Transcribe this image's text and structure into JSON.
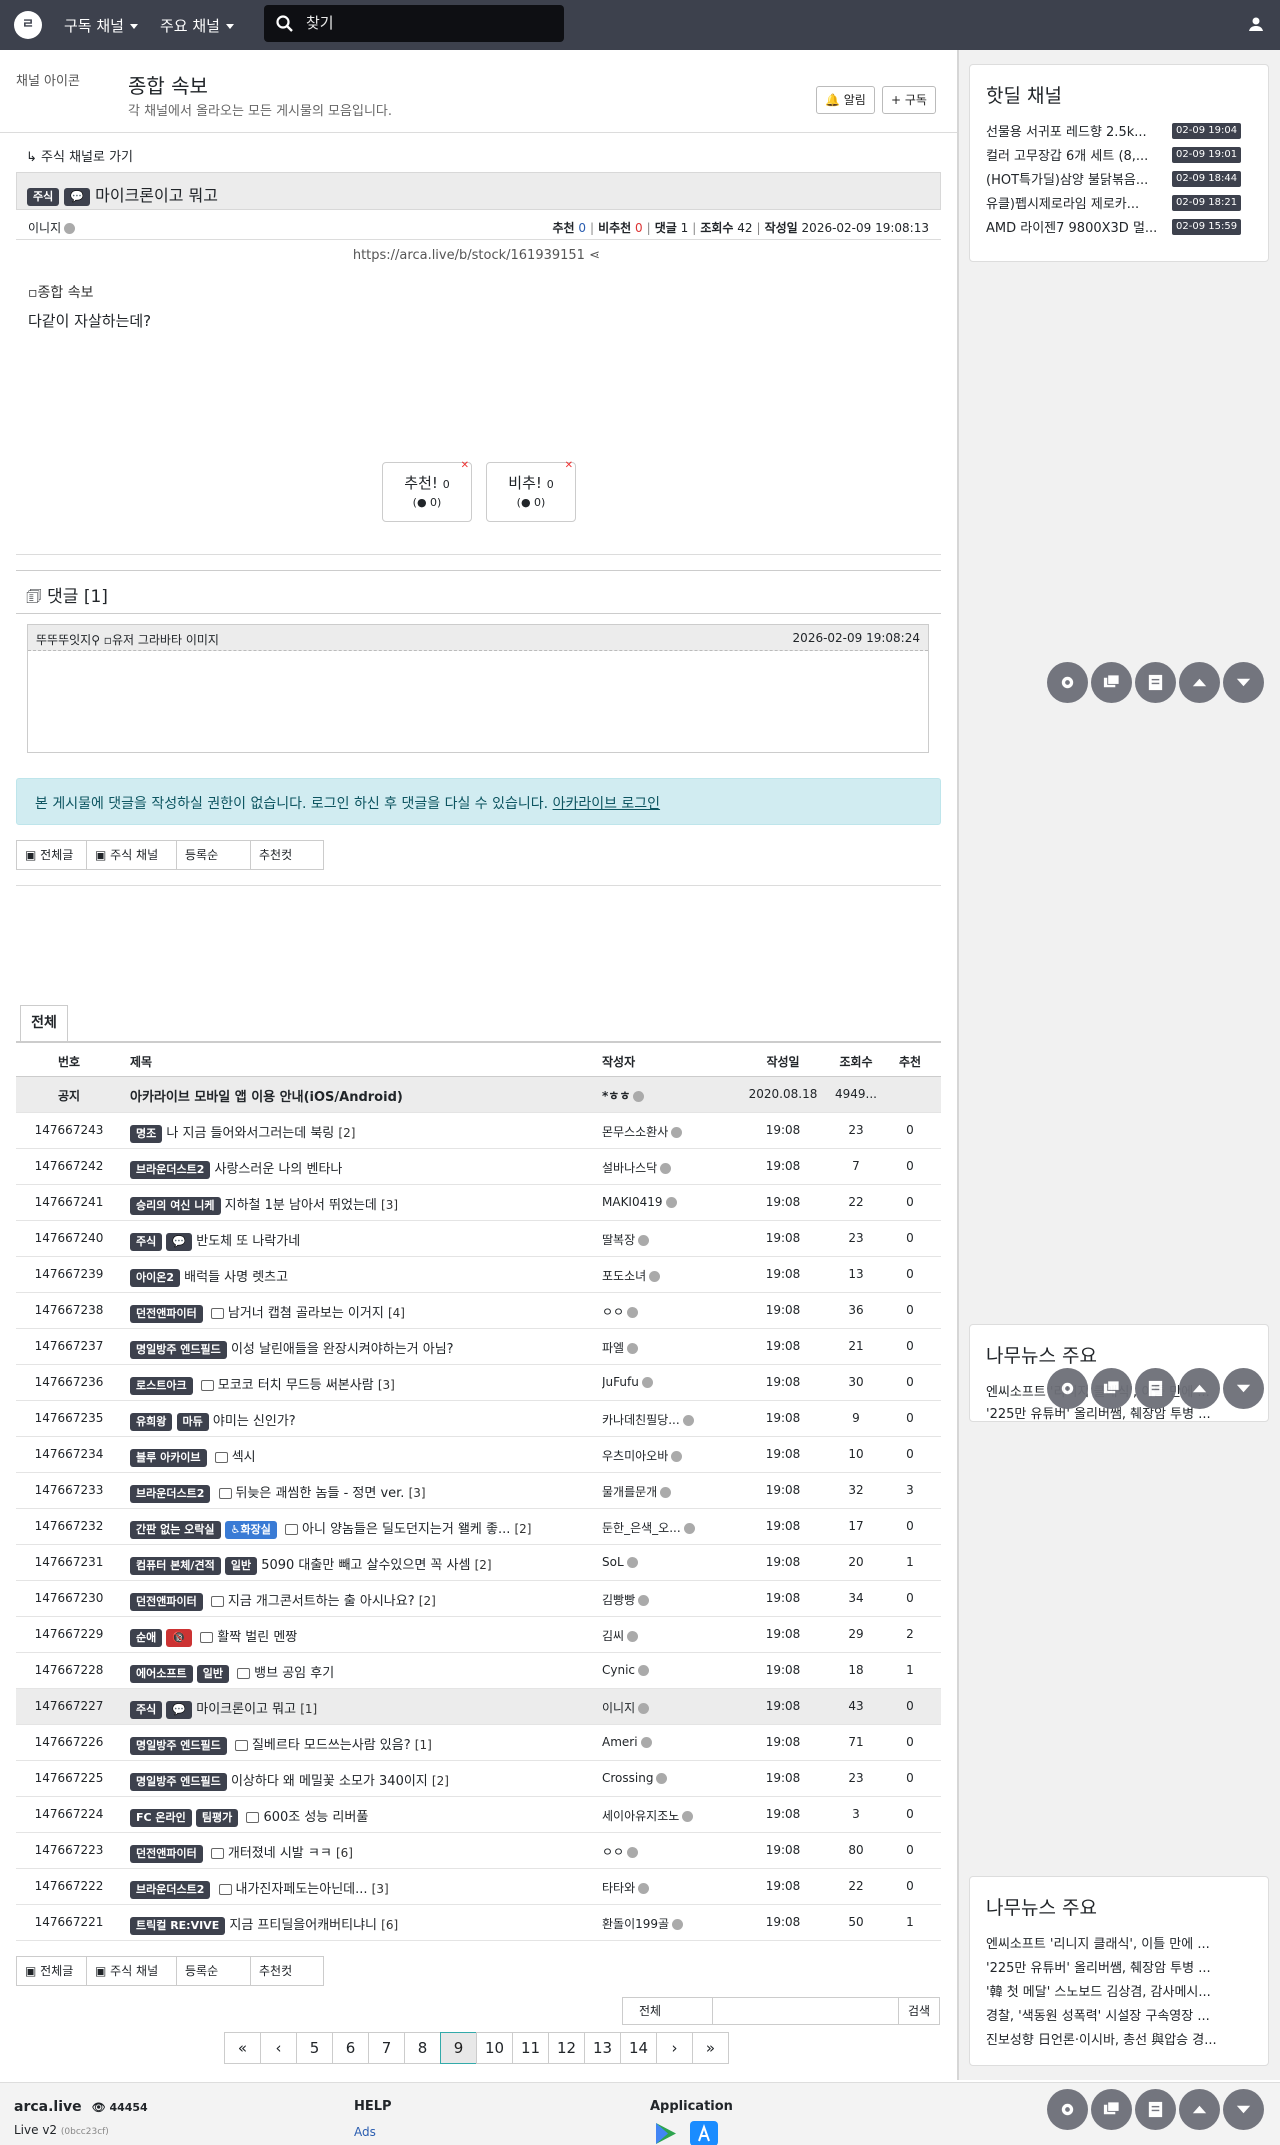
{
  "nav": {
    "logo": "ㄹ",
    "menu1": "구독 채널",
    "menu2": "주요 채널",
    "search_placeholder": "찾기"
  },
  "channel": {
    "icon_alt": "채널 아이콘",
    "title": "종합 속보",
    "description": "각 채널에서 올라오는 모든 게시물의 모음입니다.",
    "alarm_label": "알림",
    "subscribe_label": "구독"
  },
  "article": {
    "back_link": "주식 채널로 가기",
    "category": "주식",
    "title": "마이크론이고 뭐고",
    "author": "이니지",
    "stats": {
      "rec_label": "추천",
      "rec": "0",
      "unrec_label": "비추천",
      "unrec": "0",
      "comments_label": "댓글",
      "comments": "1",
      "views_label": "조회수",
      "views": "42",
      "date_label": "작성일",
      "date": "2026-02-09 19:08:13"
    },
    "url": "https://arca.live/b/stock/161939151",
    "image_alt": "종합 속보",
    "body": "다같이 자살하는데?",
    "vote_up_label": "추천!",
    "vote_up": "0",
    "vote_up_sub": "0",
    "vote_down_label": "비추!",
    "vote_down": "0",
    "vote_down_sub": "0"
  },
  "comments": {
    "title": "댓글 [1]",
    "items": [
      {
        "author": "뚜뚜뚜잇지",
        "avatar_alt": "유저 그라바타 이미지",
        "date": "2026-02-09 19:08:24"
      }
    ],
    "notice": "본 게시물에 댓글을 작성하실 권한이 없습니다. 로그인 하신 후 댓글을 다실 수 있습니다.",
    "login_link": "아카라이브 로그인"
  },
  "filters": {
    "all": "전체글",
    "channel": "주식 채널",
    "order": "등록순",
    "best": "추천컷"
  },
  "list": {
    "tab": "전체",
    "headers": {
      "no": "번호",
      "title": "제목",
      "author": "작성자",
      "date": "작성일",
      "views": "조회수",
      "rec": "추천"
    },
    "notice": {
      "no": "공지",
      "title": "아카라이브 모바일 앱 이용 안내(iOS/Android)",
      "author": "*ㅎㅎ",
      "date": "2020.08.18",
      "views": "4949...",
      "rec": ""
    },
    "rows": [
      {
        "no": "147667243",
        "badges": [
          "명조"
        ],
        "icon": false,
        "title": "나 지금 들어와서그러는데 북링",
        "cnt": "[2]",
        "author": "몬무스소환사",
        "date": "19:08",
        "views": "23",
        "rec": "0"
      },
      {
        "no": "147667242",
        "badges": [
          "브라운더스트2"
        ],
        "icon": false,
        "title": "사랑스러운 나의 벤타나",
        "cnt": "",
        "author": "설바나스닥",
        "date": "19:08",
        "views": "7",
        "rec": "0"
      },
      {
        "no": "147667241",
        "badges": [
          "승리의 여신 니케"
        ],
        "icon": false,
        "title": "지하철 1분 남아서 뛰었는데",
        "cnt": "[3]",
        "author": "MAKI0419",
        "date": "19:08",
        "views": "22",
        "rec": "0"
      },
      {
        "no": "147667240",
        "badges": [
          "주식",
          "💬"
        ],
        "icon": false,
        "title": "반도체 또 나락가네",
        "cnt": "",
        "author": "딸복장",
        "date": "19:08",
        "views": "23",
        "rec": "0"
      },
      {
        "no": "147667239",
        "badges": [
          "아이온2"
        ],
        "icon": false,
        "title": "배럭들 사명 렛츠고",
        "cnt": "",
        "author": "포도소녀",
        "date": "19:08",
        "views": "13",
        "rec": "0"
      },
      {
        "no": "147667238",
        "badges": [
          "던전앤파이터"
        ],
        "icon": true,
        "title": "남거너 캡쳠 골라보는 이거지",
        "cnt": "[4]",
        "author": "ㅇㅇ",
        "date": "19:08",
        "views": "36",
        "rec": "0"
      },
      {
        "no": "147667237",
        "badges": [
          "명일방주 엔드필드"
        ],
        "icon": false,
        "title": "이성 날린애들을 완장시켜야하는거 아님?",
        "cnt": "",
        "author": "파엘",
        "date": "19:08",
        "views": "21",
        "rec": "0"
      },
      {
        "no": "147667236",
        "badges": [
          "로스트아크"
        ],
        "icon": true,
        "title": "모코코 터치 무드등 써본사람",
        "cnt": "[3]",
        "author": "JuFufu",
        "date": "19:08",
        "views": "30",
        "rec": "0"
      },
      {
        "no": "147667235",
        "badges": [
          "유희왕",
          "마듀"
        ],
        "icon": false,
        "title": "야미는 신인가?",
        "cnt": "",
        "author": "카나데친필당...",
        "date": "19:08",
        "views": "9",
        "rec": "0"
      },
      {
        "no": "147667234",
        "badges": [
          "블루 아카이브"
        ],
        "icon": true,
        "title": "섹시",
        "cnt": "",
        "author": "우츠미아오바",
        "date": "19:08",
        "views": "10",
        "rec": "0"
      },
      {
        "no": "147667233",
        "badges": [
          "브라운더스트2"
        ],
        "icon": true,
        "title": "뒤늦은 괘씸한 놈들 - 정면 ver.",
        "cnt": "[3]",
        "author": "물개를문개",
        "date": "19:08",
        "views": "32",
        "rec": "3"
      },
      {
        "no": "147667232",
        "badges": [
          "간판 없는 오락실",
          "♿화장실"
        ],
        "icon": true,
        "title": "아니 양놈들은 딜도던지는거 왤케 좋...",
        "cnt": "[2]",
        "author": "둔한_은색_오...",
        "date": "19:08",
        "views": "17",
        "rec": "0"
      },
      {
        "no": "147667231",
        "badges": [
          "컴퓨터 본체/견적",
          "일반"
        ],
        "icon": false,
        "title": "5090 대출만 빼고 살수있으면 꼭 사셈",
        "cnt": "[2]",
        "author": "SoL",
        "date": "19:08",
        "views": "20",
        "rec": "1"
      },
      {
        "no": "147667230",
        "badges": [
          "던전앤파이터"
        ],
        "icon": true,
        "title": "지금 개그콘서트하는 출 아시나요?",
        "cnt": "[2]",
        "author": "김빵빵",
        "date": "19:08",
        "views": "34",
        "rec": "0"
      },
      {
        "no": "147667229",
        "badges": [
          "순애",
          "🔞"
        ],
        "icon": true,
        "title": "활짝 벌린 멘짱",
        "cnt": "",
        "author": "김씨",
        "date": "19:08",
        "views": "29",
        "rec": "2"
      },
      {
        "no": "147667228",
        "badges": [
          "에어소프트",
          "일반"
        ],
        "icon": true,
        "title": "뱅브 공임 후기",
        "cnt": "",
        "author": "Cynic",
        "date": "19:08",
        "views": "18",
        "rec": "1"
      },
      {
        "no": "147667227",
        "badges": [
          "주식",
          "💬"
        ],
        "icon": false,
        "title": "마이크론이고 뭐고",
        "cnt": "[1]",
        "author": "이니지",
        "date": "19:08",
        "views": "43",
        "rec": "0"
      },
      {
        "no": "147667226",
        "badges": [
          "명일방주 엔드필드"
        ],
        "icon": true,
        "title": "질베르타 모드쓰는사람 있음?",
        "cnt": "[1]",
        "author": "Ameri",
        "date": "19:08",
        "views": "71",
        "rec": "0"
      },
      {
        "no": "147667225",
        "badges": [
          "명일방주 엔드필드"
        ],
        "icon": false,
        "title": "이상하다 왜 메밀꽃 소모가 340이지",
        "cnt": "[2]",
        "author": "Crossing",
        "date": "19:08",
        "views": "23",
        "rec": "0"
      },
      {
        "no": "147667224",
        "badges": [
          "FC 온라인",
          "팀평가"
        ],
        "icon": true,
        "title": "600조 성능 리버풀",
        "cnt": "",
        "author": "세이아유지조노",
        "date": "19:08",
        "views": "3",
        "rec": "0"
      },
      {
        "no": "147667223",
        "badges": [
          "던전앤파이터"
        ],
        "icon": true,
        "title": "개터졌네 시발 ㅋㅋ",
        "cnt": "[6]",
        "author": "ㅇㅇ",
        "date": "19:08",
        "views": "80",
        "rec": "0"
      },
      {
        "no": "147667222",
        "badges": [
          "브라운더스트2"
        ],
        "icon": true,
        "title": "내가진자페도는아닌데...",
        "cnt": "[3]",
        "author": "타타와",
        "date": "19:08",
        "views": "22",
        "rec": "0"
      },
      {
        "no": "147667221",
        "badges": [
          "트릭컬 RE:VIVE"
        ],
        "icon": false,
        "title": "지금 프티딜을어캐버티냐니",
        "cnt": "[6]",
        "author": "환돌이199골",
        "date": "19:08",
        "views": "50",
        "rec": "1"
      }
    ]
  },
  "search": {
    "scope": "전체",
    "button": "검색"
  },
  "pager": {
    "pages": [
      "5",
      "6",
      "7",
      "8",
      "9",
      "10",
      "11",
      "12",
      "13",
      "14"
    ],
    "current": "9",
    "first": "«",
    "prev": "‹",
    "next": "›",
    "last": "»"
  },
  "footer": {
    "brand": "arca.live",
    "users": "44454",
    "version": "Live v2",
    "build": "(0bcc23cf)",
    "help": "HELP",
    "ads": "Ads",
    "application": "Application"
  },
  "sidebar": {
    "hotdeal_title": "핫딜 채널",
    "hotdeals": [
      {
        "title": "선물용 서귀포 레드향 2.5k...",
        "date": "02-09 19:04"
      },
      {
        "title": "컬러 고무장갑 6개 세트 (8,...",
        "date": "02-09 19:01"
      },
      {
        "title": "(HOT특가딜)삼양 불닭볶음...",
        "date": "02-09 18:44"
      },
      {
        "title": "유클)펩시제로라임 제로카...",
        "date": "02-09 18:21"
      },
      {
        "title": "AMD 라이젠7 9800X3D 멀...",
        "date": "02-09 15:59"
      }
    ],
    "news_title": "나무뉴스 주요",
    "news_partial": [
      "엔씨소프트 '리니지 클래식', 이틀 만에 ...",
      "'225만 유튜버' 올리버쌤, 췌장암 투병 ..."
    ],
    "news": [
      "엔씨소프트 '리니지 클래식', 이틀 만에 ...",
      "'225만 유튜버' 올리버쌤, 췌장암 투병 ...",
      "'韓 첫 메달' 스노보드 김상겸, 감사메시...",
      "경찰, '색동원 성폭력' 시설장 구속영장 ...",
      "진보성향 日언론·이시바, 총선 與압승 경..."
    ]
  },
  "colors": {
    "nav_bg": "#3d414d",
    "accent": "#2a5db0",
    "alert_bg": "#d1ecf1",
    "badge_bg": "#3d414d"
  }
}
